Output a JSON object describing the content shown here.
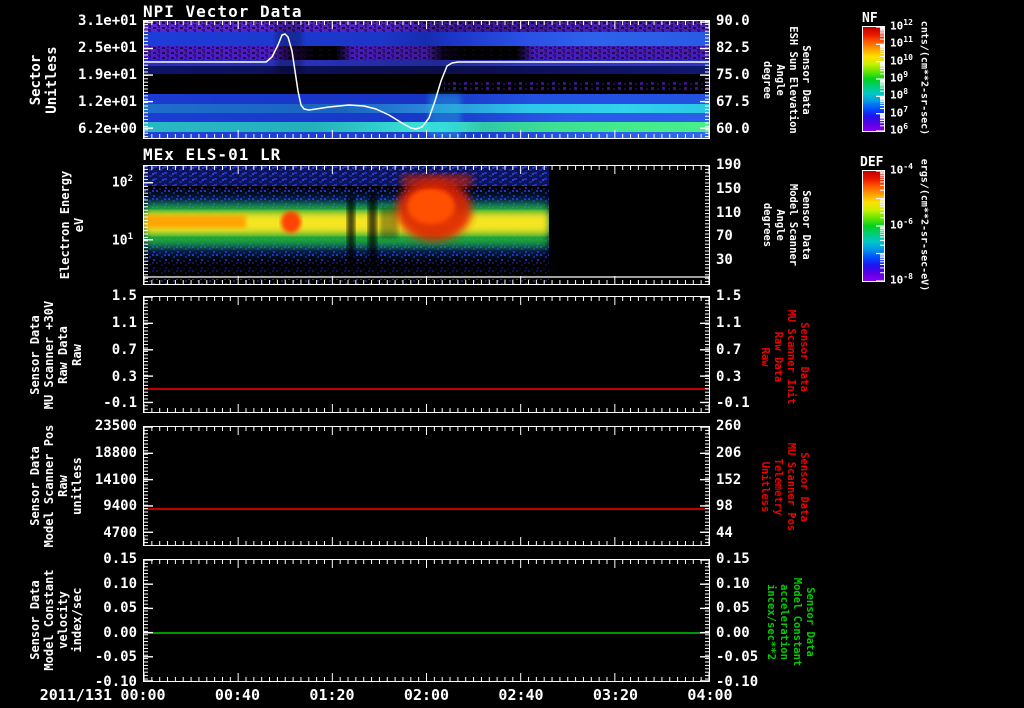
{
  "colors": {
    "background": "#000000",
    "axis": "#ffffff",
    "red_series": "#ff0000",
    "green_series": "#00c800",
    "red_label": "#ee0000",
    "green_label": "#00cc00"
  },
  "xaxis": {
    "date": "2011/131",
    "ticks": [
      "00:00",
      "00:40",
      "01:20",
      "02:00",
      "02:40",
      "03:20",
      "04:00"
    ]
  },
  "p1": {
    "title": "NPI Vector Data",
    "left_label": [
      "Sector",
      "Unitless"
    ],
    "left_ticks": [
      "3.1e+01",
      "2.5e+01",
      "1.9e+01",
      "1.2e+01",
      "6.2e+00"
    ],
    "right_ticks": [
      "90.0",
      "82.5",
      "75.0",
      "67.5",
      "60.0"
    ],
    "right_label": [
      "Sensor Data",
      "ESH Sun Elevation",
      "Angle",
      "degree"
    ],
    "cbar": {
      "title": "NF",
      "units": "cnts/(cm**2-sr-sec)",
      "ticks": [
        {
          "b": "10",
          "e": "12"
        },
        {
          "b": "10",
          "e": "11"
        },
        {
          "b": "10",
          "e": "10"
        },
        {
          "b": "10",
          "e": "9"
        },
        {
          "b": "10",
          "e": "8"
        },
        {
          "b": "10",
          "e": "7"
        },
        {
          "b": "10",
          "e": "6"
        }
      ]
    }
  },
  "p2": {
    "title": "MEx ELS-01 LR",
    "left_label": [
      "Electron Energy",
      "eV"
    ],
    "left_ticks": [
      {
        "b": "10",
        "e": "2"
      },
      {
        "b": "10",
        "e": "1"
      }
    ],
    "right_ticks": [
      "190",
      "150",
      "110",
      "70",
      "30"
    ],
    "right_label": [
      "Sensor Data",
      "Model Scanner",
      "Angle",
      "degrees"
    ],
    "cbar": {
      "title": "DEF",
      "units": "ergs/(cm**2-sr-sec-eV)",
      "ticks": [
        {
          "b": "10",
          "e": "-4"
        },
        {
          "b": "10",
          "e": "-6"
        },
        {
          "b": "10",
          "e": "-8"
        }
      ]
    }
  },
  "p3": {
    "left_label": [
      "Sensor Data",
      "MU Scanner +30V",
      "Raw Data",
      "Raw"
    ],
    "left_ticks": [
      "1.5",
      "1.1",
      "0.7",
      "0.3",
      "-0.1"
    ],
    "right_ticks": [
      "1.5",
      "1.1",
      "0.7",
      "0.3",
      "-0.1"
    ],
    "right_label": [
      "Sensor Data",
      "MU Scanner Init",
      "Raw Data",
      "Raw"
    ]
  },
  "p4": {
    "left_label": [
      "Sensor Data",
      "Model Scanner Pos",
      "Raw",
      "unitless"
    ],
    "left_ticks": [
      "23500",
      "18800",
      "14100",
      "9400",
      "4700"
    ],
    "right_ticks": [
      "260",
      "206",
      "152",
      "98",
      "44"
    ],
    "right_label": [
      "Sensor Data",
      "MU Scanner Pos",
      "Telemetry",
      "Unitless"
    ]
  },
  "p5": {
    "left_label": [
      "Sensor Data",
      "Model Constant",
      "velocity",
      "index/sec"
    ],
    "left_ticks": [
      "0.15",
      "0.10",
      "0.05",
      "0.00",
      "-0.05",
      "-0.10"
    ],
    "right_ticks": [
      "0.15",
      "0.10",
      "0.05",
      "0.00",
      "-0.05",
      "-0.10"
    ],
    "right_label": [
      "Sensor Data",
      "Model Constant",
      "acceleration",
      "incex/sec**2"
    ]
  },
  "chart_data": [
    {
      "type": "heatmap",
      "title": "NPI Vector Data",
      "ylabel": "Sector (Unitless)",
      "y_ticks": [
        31,
        25,
        19,
        12,
        6.2
      ],
      "y2label": "Sensor Data ESH Sun Elevation Angle (degree)",
      "y2_ticks": [
        90.0,
        82.5,
        75.0,
        67.5,
        60.0
      ],
      "x_date": "2011/131",
      "x_tick_labels": [
        "00:00",
        "00:40",
        "01:20",
        "02:00",
        "02:40",
        "03:20",
        "04:00"
      ],
      "colorbar": {
        "name": "NF",
        "units": "cnts/(cm**2-sr-sec)",
        "min": 1000000.0,
        "max": 1000000000000.0,
        "scale": "log"
      },
      "content": "horizontally banded sector spectrogram: speckled purple bands near sectors 21-23 and 27-30, royal blue bands between, black band near sectors 13-17, bright cyan and cyan-green bands below sector 10; colors become smoother and brighter cyan/green after ~02:45",
      "overlay_line": {
        "name": "ESH Sun Elevation (degree)",
        "x_hours": [
          0,
          0.86,
          0.95,
          0.99,
          1.04,
          1.1,
          1.3,
          1.53,
          1.72,
          1.88,
          1.94,
          2.02,
          2.1,
          2.16,
          4.0
        ],
        "y_degree": [
          79.5,
          79.5,
          84,
          87.5,
          80,
          67,
          66.5,
          67.5,
          66,
          61.5,
          60.5,
          63.5,
          73,
          79,
          79
        ]
      }
    },
    {
      "type": "heatmap",
      "title": "MEx ELS-01 LR",
      "ylabel": "Electron Energy (eV)",
      "yscale": "log",
      "y_ticks": [
        100,
        10
      ],
      "y2label": "Sensor Data Model Scanner Angle (degrees)",
      "y2_ticks": [
        190,
        150,
        110,
        70,
        30
      ],
      "colorbar": {
        "name": "DEF",
        "units": "ergs/(cm**2-sr-sec-eV)",
        "min": 1e-08,
        "max": 0.0001,
        "scale": "log"
      },
      "data_extent_hours": [
        0,
        2.86
      ],
      "content": "intense yellow-green electron flux band at ~8-40 eV from 00:00 to ~02:51; red hot spot near 01:02; large red enhancement ~01:45-02:16 extending toward 100 eV; dark vertical dropouts near 01:27 and 01:36; diffuse blue noise background; white baseline near 2 eV; no data after ~02:51"
    },
    {
      "type": "line",
      "ylabel": "Sensor Data MU Scanner +30V Raw Data (Raw)",
      "y_ticks": [
        1.5,
        1.1,
        0.7,
        0.3,
        -0.1
      ],
      "y2label": "Sensor Data MU Scanner Init Raw Data (Raw)",
      "y2_ticks": [
        1.5,
        1.1,
        0.7,
        0.3,
        -0.1
      ],
      "series": [
        {
          "name": "MU Scanner +30V Raw",
          "color": "#ff0000",
          "constant_value": 0.1,
          "x_hours": [
            0,
            4
          ]
        }
      ]
    },
    {
      "type": "line",
      "ylabel": "Sensor Data Model Scanner Pos Raw (unitless)",
      "y_ticks": [
        23500,
        18800,
        14100,
        9400,
        4700
      ],
      "y2label": "Sensor Data MU Scanner Pos Telemetry (Unitless)",
      "y2_ticks": [
        260,
        206,
        152,
        98,
        44
      ],
      "series": [
        {
          "name": "Model Scanner Pos Raw",
          "color": "#ff0000",
          "constant_value": 8800,
          "x_hours": [
            0,
            4
          ]
        }
      ]
    },
    {
      "type": "line",
      "ylabel": "Sensor Data Model Constant velocity (index/sec)",
      "y_ticks": [
        0.15,
        0.1,
        0.05,
        0.0,
        -0.05,
        -0.1
      ],
      "y2label": "Sensor Data Model Constant acceleration (incex/sec**2)",
      "y2_ticks": [
        0.15,
        0.1,
        0.05,
        0.0,
        -0.05,
        -0.1
      ],
      "series": [
        {
          "name": "Model Constant velocity",
          "color": "#00c800",
          "constant_value": 0.0,
          "x_hours": [
            0,
            4
          ]
        }
      ]
    }
  ]
}
